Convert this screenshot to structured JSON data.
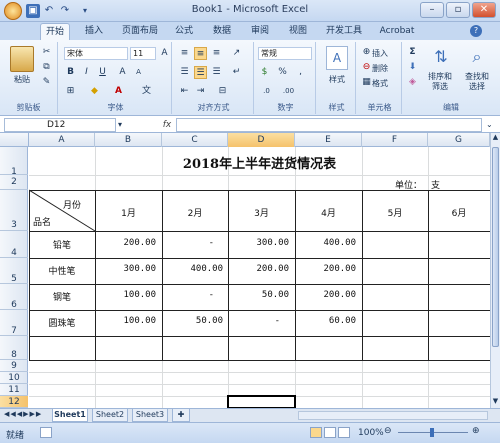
{
  "app": {
    "title": "Book1 - Microsoft Excel"
  },
  "quick_access": {
    "undo_label": "↶",
    "redo_label": "↷"
  },
  "tabs": [
    "开始",
    "插入",
    "页面布局",
    "公式",
    "数据",
    "审阅",
    "视图",
    "开发工具",
    "Acrobat"
  ],
  "ribbon": {
    "clipboard": {
      "label": "剪贴板",
      "paste": "粘贴"
    },
    "font": {
      "label": "字体",
      "name": "宋体",
      "size": "11"
    },
    "alignment": {
      "label": "对齐方式"
    },
    "number": {
      "label": "数字",
      "format": "常规"
    },
    "styles": {
      "label": "样式",
      "button": "样式"
    },
    "cells": {
      "label": "单元格",
      "insert": "插入",
      "delete": "删除",
      "format": "格式"
    },
    "editing": {
      "label": "编辑",
      "sort": "排序和\n筛选",
      "find": "查找和\n选择"
    }
  },
  "namebox": "D12",
  "fx_label": "fx",
  "columns": [
    "A",
    "B",
    "C",
    "D",
    "E",
    "F",
    "G"
  ],
  "rows": [
    "1",
    "2",
    "3",
    "4",
    "5",
    "6",
    "7",
    "8",
    "9",
    "10",
    "11",
    "12"
  ],
  "sheet": {
    "title": "2018年上半年进货情况表",
    "unit_label": "单位：",
    "unit_value": "支",
    "corner_top": "月份",
    "corner_bottom": "品名",
    "months": [
      "1月",
      "2月",
      "3月",
      "4月",
      "5月",
      "6月"
    ],
    "products": [
      {
        "name": "铅笔",
        "values": [
          "200.00",
          "-",
          "300.00",
          "400.00",
          "",
          ""
        ]
      },
      {
        "name": "中性笔",
        "values": [
          "300.00",
          "400.00",
          "200.00",
          "200.00",
          "",
          ""
        ]
      },
      {
        "name": "钢笔",
        "values": [
          "100.00",
          "-",
          "50.00",
          "200.00",
          "",
          ""
        ]
      },
      {
        "name": "圆珠笔",
        "values": [
          "100.00",
          "50.00",
          "-",
          "60.00",
          "",
          ""
        ]
      }
    ]
  },
  "sheet_tabs": [
    "Sheet1",
    "Sheet2",
    "Sheet3"
  ],
  "status": {
    "mode": "就绪",
    "zoom": "100%"
  }
}
